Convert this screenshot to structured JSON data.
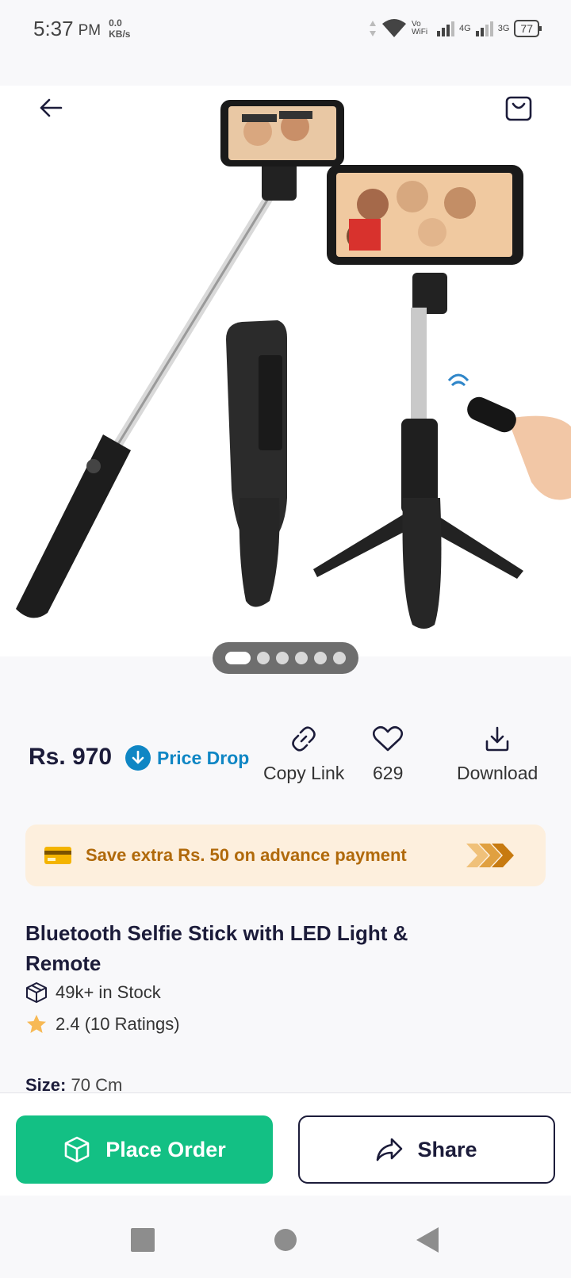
{
  "status_bar": {
    "time": "5:37",
    "ampm": "PM",
    "speed_value": "0.0",
    "speed_unit": "KB/s",
    "vowifi": "Vo WiFi",
    "net1": "4G",
    "net2": "3G",
    "battery": "77"
  },
  "gallery": {
    "image_count": 6,
    "active_index": 0
  },
  "product": {
    "price": "Rs. 970",
    "price_drop_label": "Price Drop",
    "copy_link_label": "Copy Link",
    "wishlist_count": "629",
    "download_label": "Download",
    "offer_text": "Save extra Rs. 50 on advance payment",
    "title": "Bluetooth Selfie Stick with LED Light & Remote",
    "stock_text": "49k+ in Stock",
    "rating_text": "2.4 (10 Ratings)",
    "size_label": "Size:",
    "size_value": "70 Cm"
  },
  "actions": {
    "place_order_label": "Place Order",
    "share_label": "Share"
  },
  "colors": {
    "primary_green": "#13c084",
    "price_drop_blue": "#0f86c4",
    "offer_bg": "#fdefdd",
    "offer_text": "#b0690a",
    "dark_navy": "#1c1c3a",
    "star": "#f7b955"
  },
  "icons": {
    "back": "arrow-left-icon",
    "cart": "shopping-bag-icon",
    "copy_link": "link-icon",
    "wishlist": "heart-icon",
    "download": "download-icon",
    "price_drop": "arrow-down-circle-icon",
    "offer": "credit-card-icon",
    "stock": "box-icon",
    "rating": "star-icon",
    "place_order": "box-icon",
    "share": "share-arrow-icon"
  }
}
